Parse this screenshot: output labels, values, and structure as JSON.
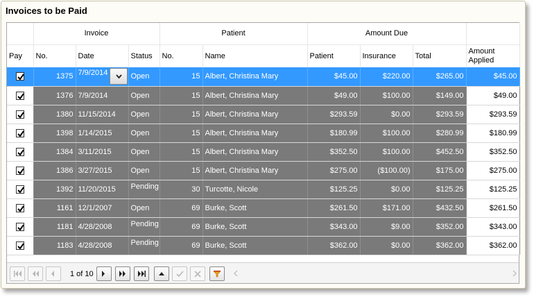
{
  "title": "Invoices to be Paid",
  "groups": {
    "invoice": "Invoice",
    "patient": "Patient",
    "amount_due": "Amount Due"
  },
  "columns": {
    "pay": "Pay",
    "inv_no": "No.",
    "date": "Date",
    "status": "Status",
    "pat_no": "No.",
    "name": "Name",
    "patient": "Patient",
    "insurance": "Insurance",
    "total": "Total",
    "applied_1": "Amount",
    "applied_2": "Applied"
  },
  "rows": [
    {
      "pay": true,
      "inv_no": "1375",
      "date": "7/9/2014",
      "status": "Open",
      "pat_no": "15",
      "name": "Albert, Christina Mary",
      "patient": "$45.00",
      "insurance": "$220.00",
      "total": "$265.00",
      "applied": "$45.00"
    },
    {
      "pay": true,
      "inv_no": "1376",
      "date": "7/9/2014",
      "status": "Open",
      "pat_no": "15",
      "name": "Albert, Christina Mary",
      "patient": "$49.00",
      "insurance": "$100.00",
      "total": "$149.00",
      "applied": "$49.00"
    },
    {
      "pay": true,
      "inv_no": "1380",
      "date": "11/15/2014",
      "status": "Open",
      "pat_no": "15",
      "name": "Albert, Christina Mary",
      "patient": "$293.59",
      "insurance": "$0.00",
      "total": "$293.59",
      "applied": "$293.59"
    },
    {
      "pay": true,
      "inv_no": "1398",
      "date": "1/14/2015",
      "status": "Open",
      "pat_no": "15",
      "name": "Albert, Christina Mary",
      "patient": "$180.99",
      "insurance": "$100.00",
      "total": "$280.99",
      "applied": "$180.99"
    },
    {
      "pay": true,
      "inv_no": "1384",
      "date": "3/11/2015",
      "status": "Open",
      "pat_no": "15",
      "name": "Albert, Christina Mary",
      "patient": "$352.50",
      "insurance": "$100.00",
      "total": "$452.50",
      "applied": "$352.50"
    },
    {
      "pay": true,
      "inv_no": "1386",
      "date": "3/27/2015",
      "status": "Open",
      "pat_no": "15",
      "name": "Albert, Christina Mary",
      "patient": "$275.00",
      "insurance": "($100.00)",
      "total": "$175.00",
      "applied": "$275.00"
    },
    {
      "pay": true,
      "inv_no": "1392",
      "date": "11/20/2015",
      "status": "Pending",
      "pat_no": "30",
      "name": "Turcotte, Nicole",
      "patient": "$125.25",
      "insurance": "$0.00",
      "total": "$125.25",
      "applied": "$125.25"
    },
    {
      "pay": true,
      "inv_no": "1161",
      "date": "12/1/2007",
      "status": "Open",
      "pat_no": "69",
      "name": "Burke, Scott",
      "patient": "$261.50",
      "insurance": "$171.00",
      "total": "$432.50",
      "applied": "$261.50"
    },
    {
      "pay": true,
      "inv_no": "1181",
      "date": "4/28/2008",
      "status": "Pending",
      "pat_no": "69",
      "name": "Burke, Scott",
      "patient": "$343.00",
      "insurance": "$9.00",
      "total": "$352.00",
      "applied": "$343.00"
    },
    {
      "pay": true,
      "inv_no": "1183",
      "date": "4/28/2008",
      "status": "Pending",
      "pat_no": "69",
      "name": "Burke, Scott",
      "patient": "$362.00",
      "insurance": "$0.00",
      "total": "$362.00",
      "applied": "$362.00"
    }
  ],
  "selected_row": 0,
  "pager": {
    "page_info": "1 of 10"
  },
  "icons": {
    "first": "first-page-icon",
    "prev_block": "previous-block-icon",
    "prev": "previous-page-icon",
    "next": "next-page-icon",
    "next_block": "next-block-icon",
    "last": "last-page-icon",
    "up": "move-up-icon",
    "accept": "checkmark-icon",
    "cancel": "cancel-icon",
    "filter": "filter-icon",
    "scroll_left": "scroll-left-icon",
    "scroll_right": "scroll-right-icon",
    "dropdown": "chevron-down-icon"
  },
  "colors": {
    "selection": "#3399ff",
    "row_bg": "#7a7a7a",
    "filter": "#e8a317"
  }
}
